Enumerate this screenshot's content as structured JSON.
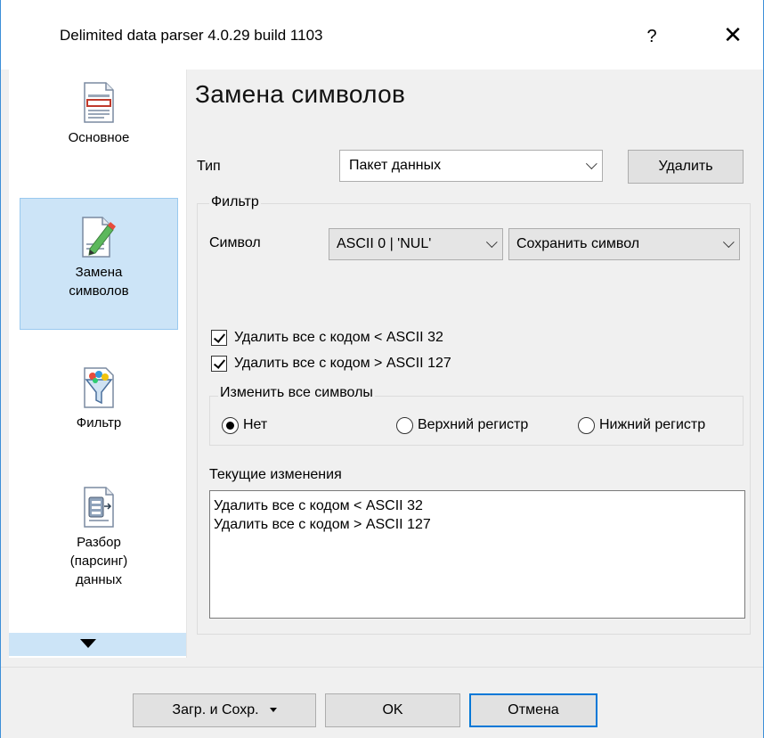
{
  "window": {
    "title": "Delimited data parser 4.0.29 build 1103",
    "help_label": "?",
    "close_label": "✕"
  },
  "sidebar": {
    "items": [
      {
        "label": "Основное",
        "icon": "document-icon"
      },
      {
        "label": "Замена символов",
        "label_line1": "Замена",
        "label_line2": "символов",
        "icon": "pencil-document-icon",
        "active": true
      },
      {
        "label": "Фильтр",
        "icon": "funnel-icon"
      },
      {
        "label": "Разбор (парсинг) данных",
        "label_line1": "Разбор",
        "label_line2": "(парсинг)",
        "label_line3": "данных",
        "icon": "parser-document-icon"
      }
    ]
  },
  "main": {
    "page_title": "Замена символов",
    "type_label": "Тип",
    "type_value": "Пакет данных",
    "delete_button": "Удалить",
    "filter_group": {
      "legend": "Фильтр",
      "symbol_label": "Символ",
      "symbol_value": "ASCII 0 | 'NUL'",
      "action_value": "Сохранить символ"
    },
    "checkboxes": [
      {
        "label": "Удалить все с кодом < ASCII 32",
        "checked": true
      },
      {
        "label": "Удалить все с кодом > ASCII 127",
        "checked": true
      }
    ],
    "case_group": {
      "legend": "Изменить все символы",
      "options": [
        {
          "label": "Нет",
          "selected": true
        },
        {
          "label": "Верхний регистр",
          "selected": false
        },
        {
          "label": "Нижний регистр",
          "selected": false
        }
      ]
    },
    "current_changes": {
      "label": "Текущие изменения",
      "lines": [
        "Удалить все с кодом < ASCII 32",
        "Удалить все с кодом > ASCII 127"
      ]
    }
  },
  "footer": {
    "load_save_button": "Загр. и Сохр.",
    "ok_button": "OK",
    "cancel_button": "Отмена"
  },
  "colors": {
    "accent": "#0078d7",
    "selection": "#cce4f7",
    "window_border": "#3c8fd8"
  }
}
